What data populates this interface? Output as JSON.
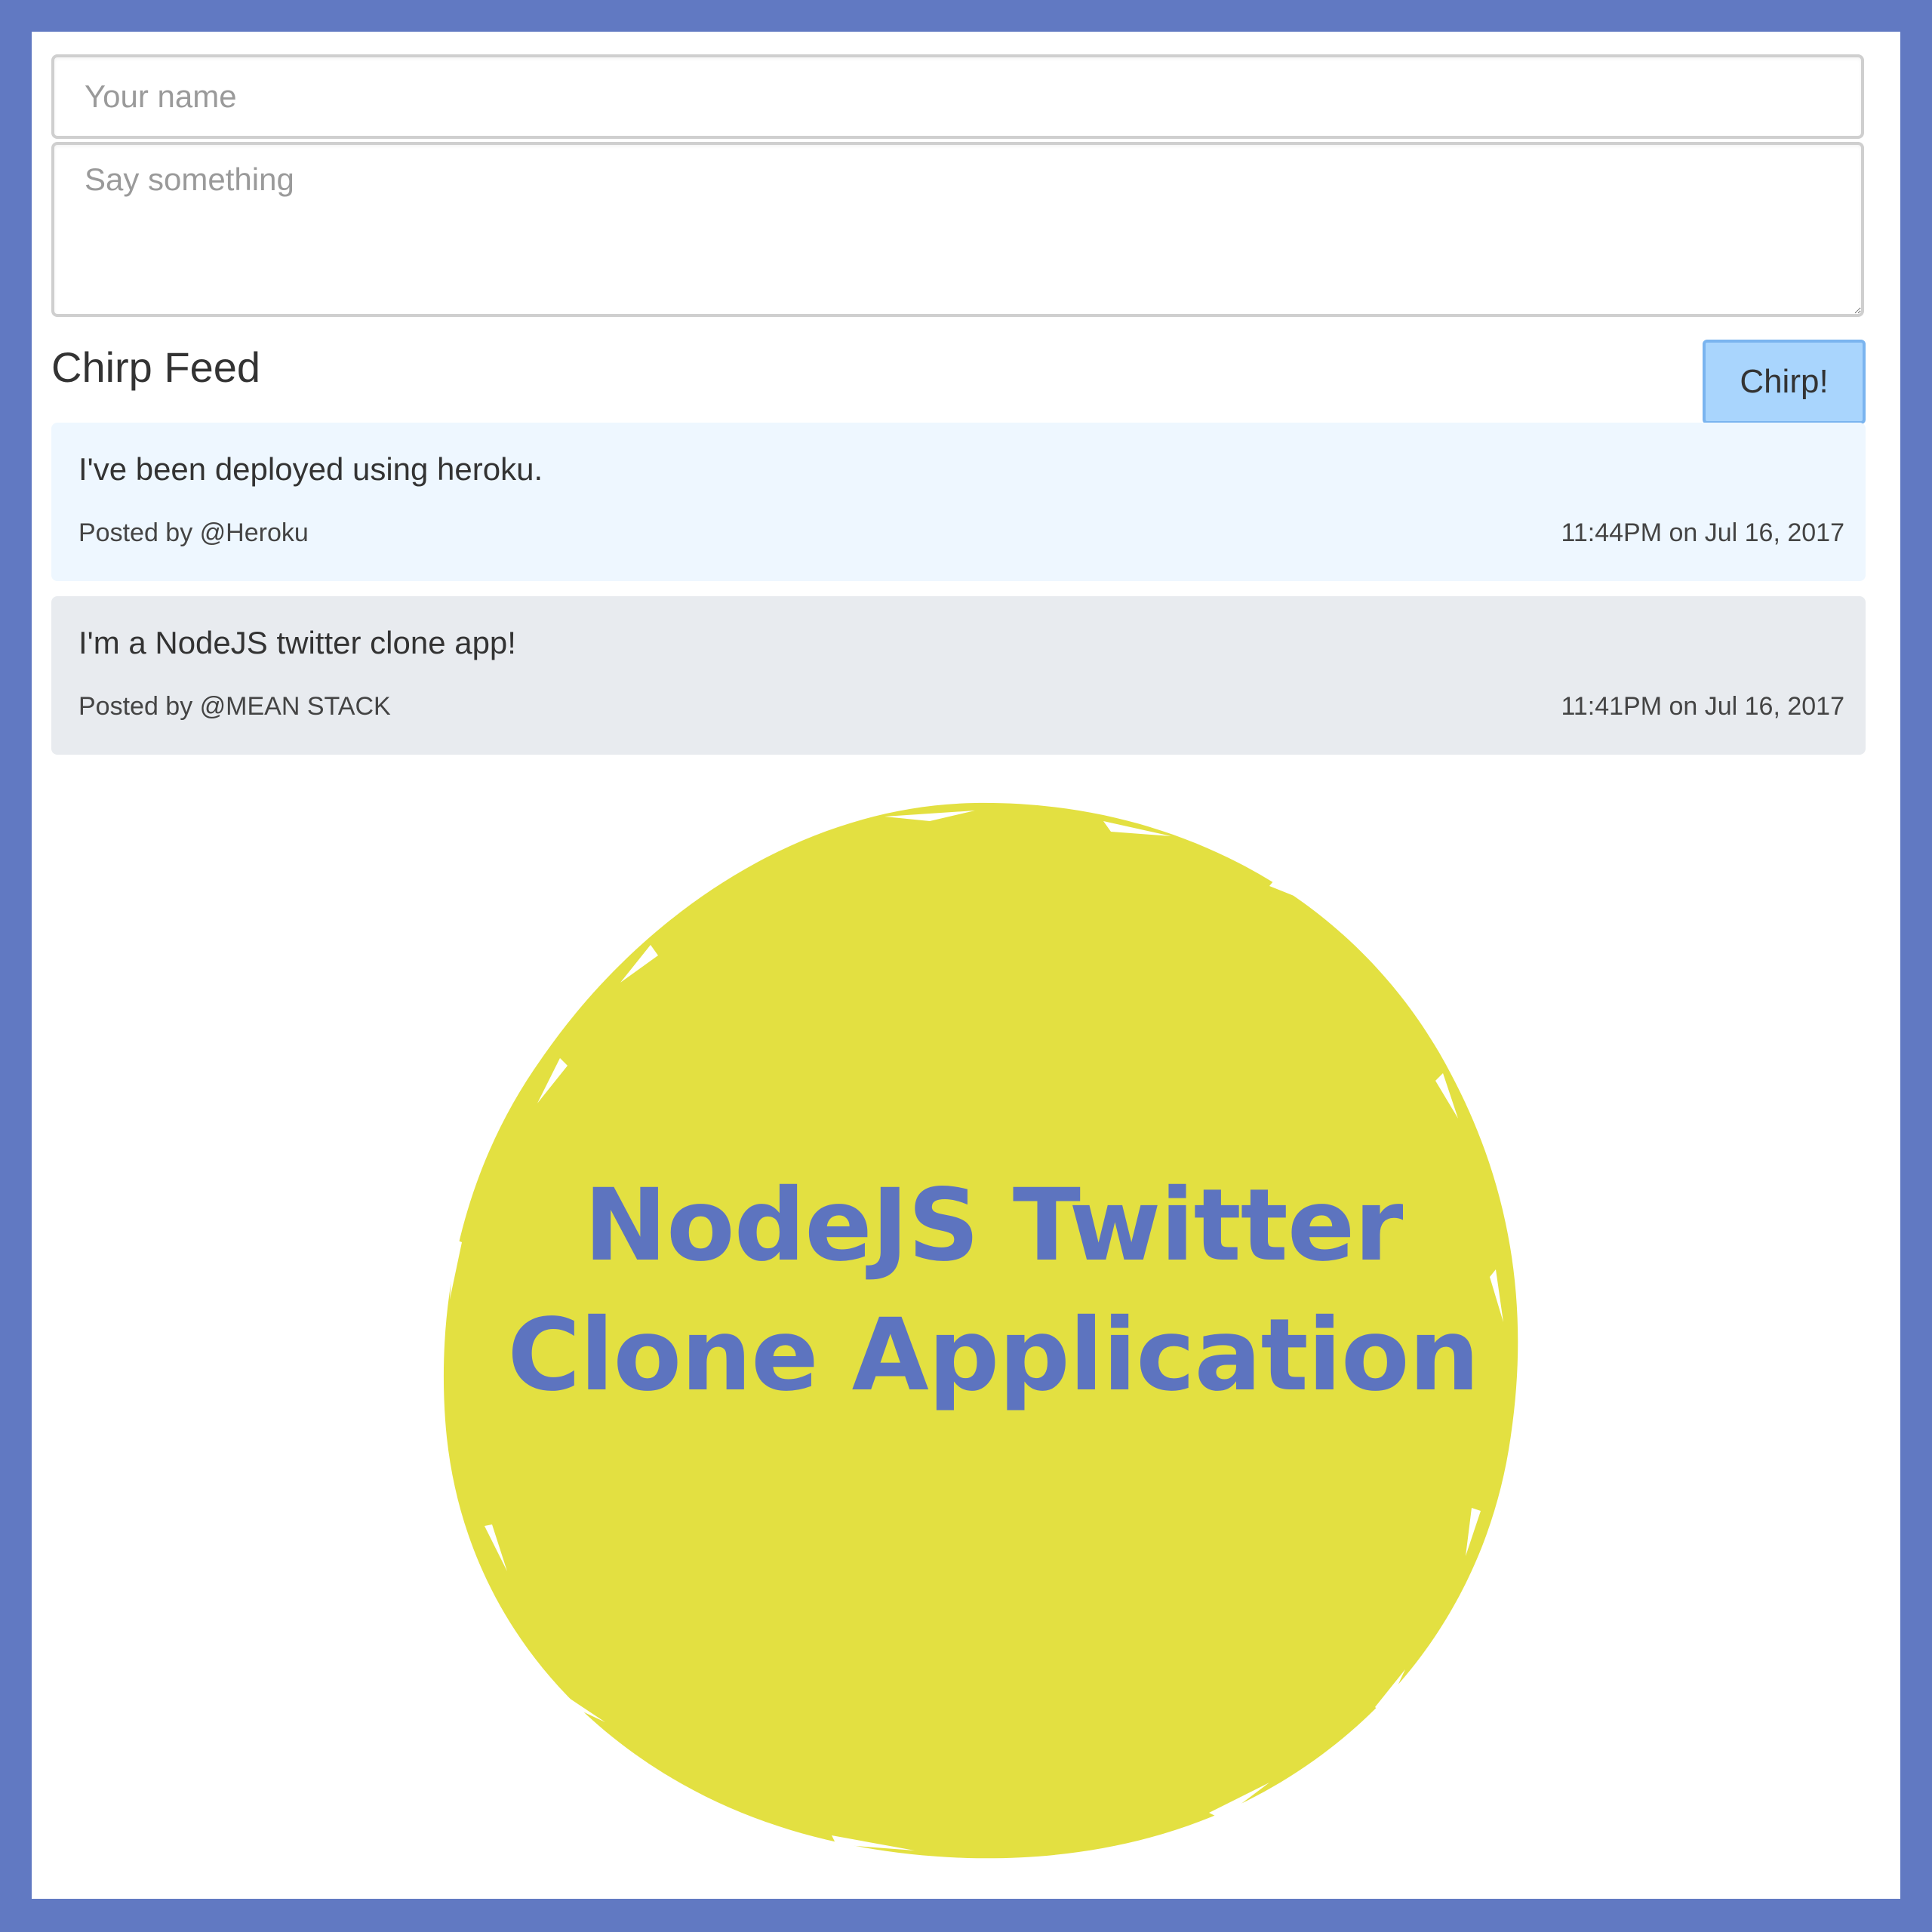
{
  "form": {
    "name_placeholder": "Your name",
    "message_placeholder": "Say something",
    "submit_label": "Chirp!"
  },
  "feed": {
    "title": "Chirp Feed",
    "posts": [
      {
        "text": "I've been deployed using heroku.",
        "author": "Posted by @Heroku",
        "timestamp": "11:44PM on Jul 16, 2017"
      },
      {
        "text": "I'm a NodeJS twitter clone app!",
        "author": "Posted by @MEAN STACK",
        "timestamp": "11:41PM on Jul 16, 2017"
      }
    ]
  },
  "badge": {
    "line1": "NodeJS Twitter",
    "line2": "Clone Application"
  },
  "colors": {
    "frame": "#6179c2",
    "badge_fill": "#e3e041",
    "badge_text": "#5d74bf",
    "button": "#a9d5fd",
    "post_highlight": "#eef7ff",
    "post_default": "#e8ebef"
  }
}
